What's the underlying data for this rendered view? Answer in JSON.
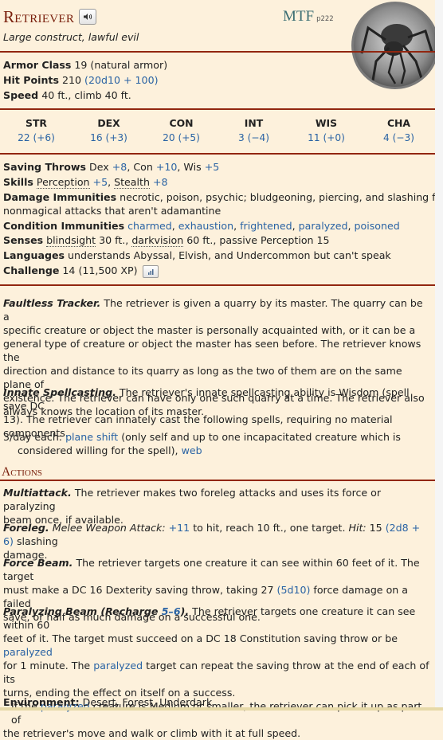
{
  "header": {
    "name": "Retriever",
    "source_abbr": "MTF",
    "source_page": "p222",
    "subtitle": "Large construct, lawful evil"
  },
  "basics": {
    "ac_label": "Armor Class",
    "ac_value": "19 (natural armor)",
    "hp_label": "Hit Points",
    "hp_value": "210",
    "hp_formula": "(20d10 + 100)",
    "speed_label": "Speed",
    "speed_value": "40 ft., climb 40 ft."
  },
  "abilities": [
    {
      "name": "STR",
      "value": "22 (+6)"
    },
    {
      "name": "DEX",
      "value": "16 (+3)"
    },
    {
      "name": "CON",
      "value": "20 (+5)"
    },
    {
      "name": "INT",
      "value": "3 (−4)"
    },
    {
      "name": "WIS",
      "value": "11 (+0)"
    },
    {
      "name": "CHA",
      "value": "4 (−3)"
    }
  ],
  "details": {
    "saves_label": "Saving Throws",
    "saves": [
      {
        "name": "Dex",
        "bonus": "+8"
      },
      {
        "name": "Con",
        "bonus": "+10"
      },
      {
        "name": "Wis",
        "bonus": "+5"
      }
    ],
    "skills_label": "Skills",
    "skills": [
      {
        "name": "Perception",
        "bonus": "+5"
      },
      {
        "name": "Stealth",
        "bonus": "+8"
      }
    ],
    "dmg_imm_label": "Damage Immunities",
    "dmg_imm_line1": "necrotic, poison, psychic; bludgeoning, piercing, and slashing from",
    "dmg_imm_line2": "nonmagical attacks that aren't adamantine",
    "cond_imm_label": "Condition Immunities",
    "cond_imm": [
      "charmed",
      "exhaustion",
      "frightened",
      "paralyzed",
      "poisoned"
    ],
    "senses_label": "Senses",
    "senses_blindsight": "blindsight",
    "senses_blind_rest": "30 ft.,",
    "senses_darkvision": "darkvision",
    "senses_dark_rest": "60 ft., passive Perception 15",
    "languages_label": "Languages",
    "languages_value": "understands Abyssal, Elvish, and Undercommon but can't speak",
    "challenge_label": "Challenge",
    "challenge_value": "14 (11,500 XP)"
  },
  "traits": {
    "faultless_name": "Faultless Tracker.",
    "faultless_lines": [
      "The retriever is given a quarry by its master. The quarry can be a",
      "specific creature or object the master is personally acquainted with, or it can be a",
      "general type of creature or object the master has seen before. The retriever knows the",
      "direction and distance to its quarry as long as the two of them are on the same plane of",
      "existence. The retriever can have only one such quarry at a time. The retriever also",
      "always knows the location of its master."
    ],
    "innate_name": "Innate Spellcasting.",
    "innate_lines": [
      "The retriever's innate spellcasting ability is Wisdom (spell save DC",
      "13). The retriever can innately cast the following spells, requiring no material",
      "components."
    ],
    "spells_prefix": "3/day each:",
    "spell1": "plane shift",
    "spells_mid1": "(only self and up to one incapacitated creature which is",
    "spells_mid2": "considered willing for the spell),",
    "spell2": "web"
  },
  "actions": {
    "heading": "Actions",
    "multi_name": "Multiattack.",
    "multi_l1": "The retriever makes two foreleg attacks and uses its force or paralyzing",
    "multi_l2": "beam once, if available.",
    "foreleg_name": "Foreleg.",
    "foreleg_type": "Melee Weapon Attack:",
    "foreleg_bonus": "+11",
    "foreleg_mid": "to hit, reach 10 ft., one target.",
    "foreleg_hit": "Hit:",
    "foreleg_avg": "15",
    "foreleg_dice": "(2d8 + 6)",
    "foreleg_end": "slashing",
    "foreleg_l2": "damage.",
    "force_name": "Force Beam.",
    "force_l1": "The retriever targets one creature it can see within 60 feet of it. The target",
    "force_l2a": "must make a DC 16 Dexterity saving throw, taking 27",
    "force_dice": "(5d10)",
    "force_l2b": "force damage on a failed",
    "force_l3": "save, or half as much damage on a successful one.",
    "para_name": "Paralyzing Beam (Recharge",
    "para_recharge": "5–6",
    "para_name_end": ").",
    "para_l1": "The retriever targets one creature it can see within 60",
    "para_l2a": "feet of it. The target must succeed on a DC 18 Constitution saving throw or be",
    "para_cond": "paralyzed",
    "para_l3a": "for 1 minute. The",
    "para_l3b": "target can repeat the saving throw at the end of each of its",
    "para_l4": "turns, ending the effect on itself on a success.",
    "para_l5a": "If the",
    "para_l5b": "creature is Medium or smaller, the retriever can pick it up as part of",
    "para_l6": "the retriever's move and walk or climb with it at full speed."
  },
  "environment": {
    "label": "Environment:",
    "value": "Desert, Forest, Underdark"
  }
}
